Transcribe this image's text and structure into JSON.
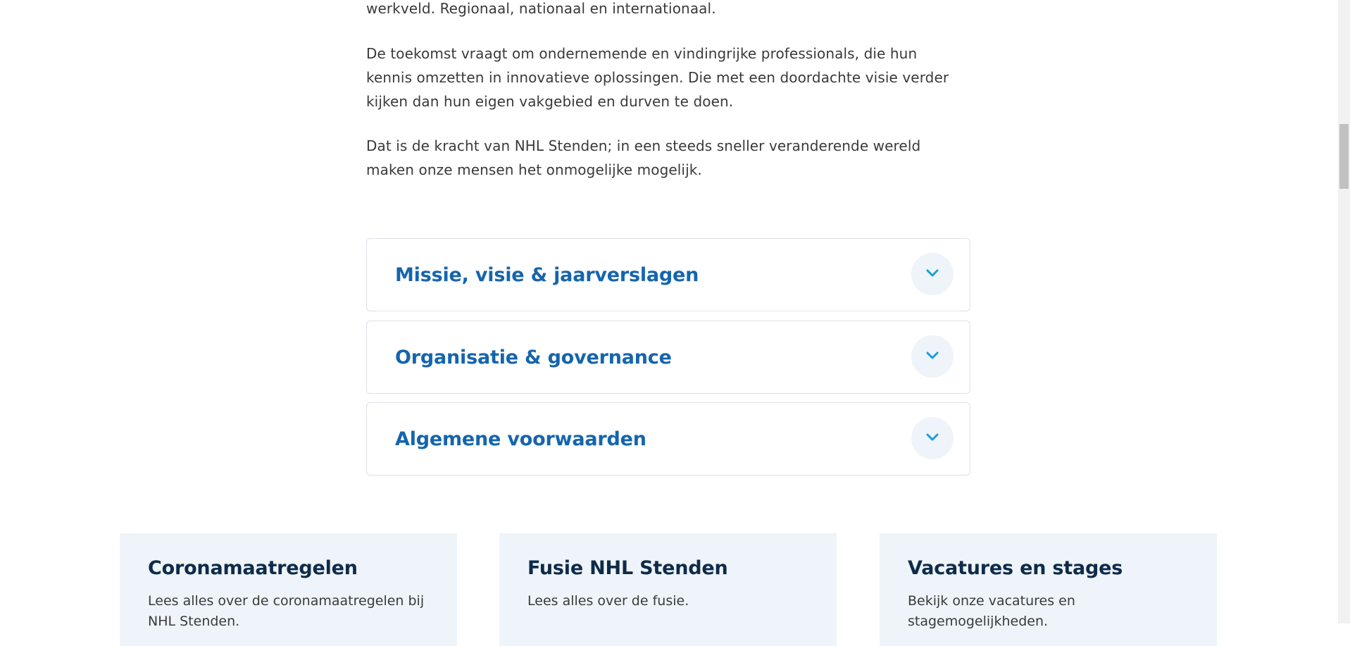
{
  "intro": {
    "paragraphs": [
      "werkveld. Regionaal, nationaal en internationaal.",
      "De toekomst vraagt om ondernemende en vindingrijke professionals, die hun kennis omzetten in innovatieve oplossingen. Die met een doordachte visie verder kijken dan hun eigen vakgebied en durven te doen.",
      "Dat is de kracht van NHL Stenden; in een steeds sneller veranderende wereld maken onze mensen het onmogelijke mogelijk."
    ]
  },
  "accordion": {
    "items": [
      {
        "title": "Missie, visie & jaarverslagen",
        "icon": "chevron-down-icon"
      },
      {
        "title": "Organisatie & governance",
        "icon": "chevron-down-icon"
      },
      {
        "title": "Algemene voorwaarden",
        "icon": "chevron-down-icon"
      }
    ]
  },
  "cards": [
    {
      "title": "Coronamaatregelen",
      "text": "Lees alles over de coronamaatregelen bij NHL Stenden."
    },
    {
      "title": "Fusie NHL Stenden",
      "text": "Lees alles over de fusie."
    },
    {
      "title": "Vacatures en stages",
      "text": "Bekijk onze vacatures en stagemogelijkheden."
    }
  ],
  "colors": {
    "accent": "#1565ad",
    "chevron": "#1a9fd6",
    "card_bg": "#eef4f9",
    "heading_dark": "#0f2b4a"
  }
}
